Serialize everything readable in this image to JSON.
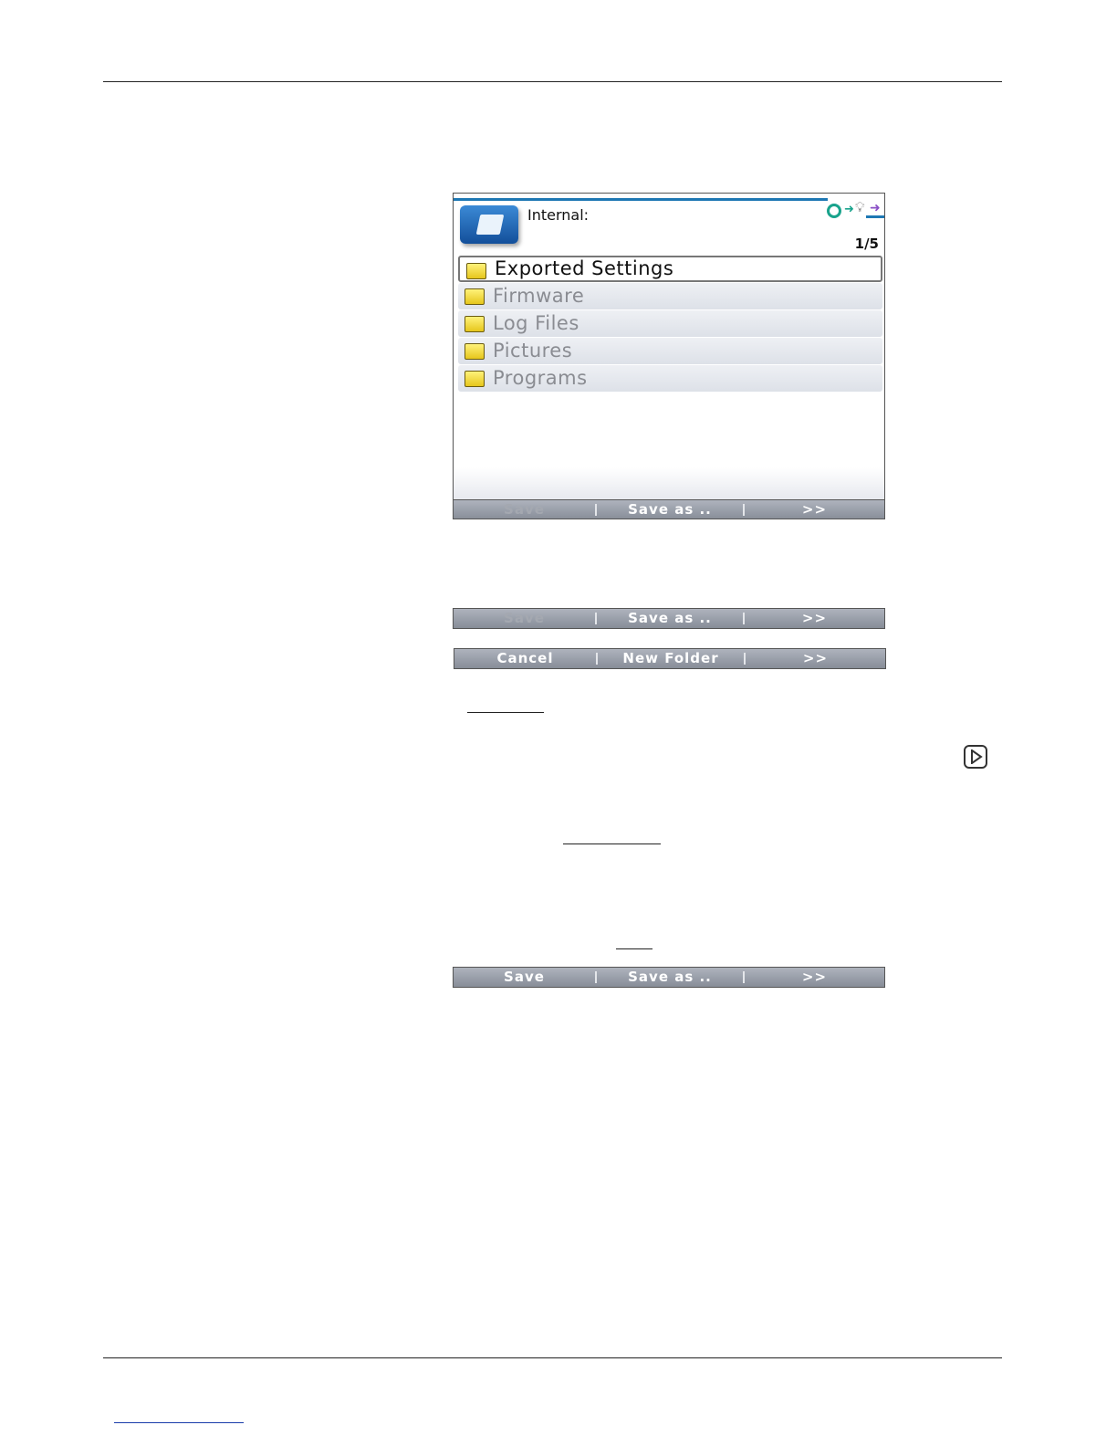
{
  "device_screen": {
    "location": "Internal:",
    "page_counter": "1/5",
    "folders": [
      {
        "label": "Exported Settings",
        "selected": true
      },
      {
        "label": "Firmware",
        "selected": false
      },
      {
        "label": "Log Files",
        "selected": false
      },
      {
        "label": "Pictures",
        "selected": false
      },
      {
        "label": "Programs",
        "selected": false
      }
    ],
    "softkeys": {
      "k1": "Save",
      "k2": "Save as ..",
      "k3": ">>"
    }
  },
  "softkey_bar_a": {
    "k1": "Save",
    "k2": "Save as ..",
    "k3": ">>",
    "k1_disabled": true
  },
  "softkey_bar_b": {
    "k1": "Cancel",
    "k2": "New Folder",
    "k3": ">>"
  },
  "softkey_bar_c": {
    "k1": "Save",
    "k2": "Save as ..",
    "k3": ">>",
    "k1_disabled": false
  },
  "icons": {
    "play": "play-button-icon",
    "folder": "folder-icon",
    "app": "file-browser-icon"
  },
  "colors": {
    "accent": "#1e78b4",
    "softkey_bar": "#9ba0aa",
    "folder": "#f2dc3c"
  }
}
